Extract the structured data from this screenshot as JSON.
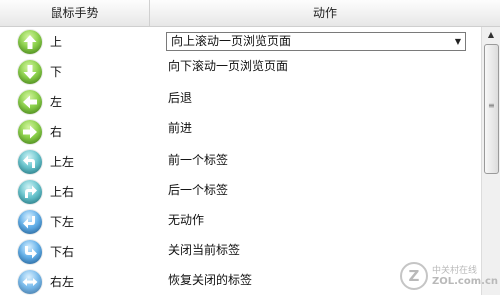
{
  "header": {
    "gesture_col": "鼠标手势",
    "action_col": "动作"
  },
  "colors": {
    "green_icon": "#7cc242",
    "blue_icon": "#4a9ee0",
    "teal_icon": "#49b3bf"
  },
  "rows": [
    {
      "gesture": "上",
      "icon": "arrow-up-icon",
      "action": "向上滚动一页浏览页面"
    },
    {
      "gesture": "下",
      "icon": "arrow-down-icon",
      "action": "向下滚动一页浏览页面"
    },
    {
      "gesture": "左",
      "icon": "arrow-left-icon",
      "action": "后退"
    },
    {
      "gesture": "右",
      "icon": "arrow-right-icon",
      "action": "前进"
    },
    {
      "gesture": "上左",
      "icon": "arrow-up-left-icon",
      "action": "前一个标签"
    },
    {
      "gesture": "上右",
      "icon": "arrow-up-right-icon",
      "action": "后一个标签"
    },
    {
      "gesture": "下左",
      "icon": "arrow-down-left-icon",
      "action": "无动作"
    },
    {
      "gesture": "下右",
      "icon": "arrow-down-right-icon",
      "action": "关闭当前标签"
    },
    {
      "gesture": "右左",
      "icon": "arrow-right-left-icon",
      "action": "恢复关闭的标签"
    }
  ],
  "scrollbar": {
    "up_arrow": "▲",
    "grip": "≡"
  },
  "dropdown_arrow": "▼",
  "watermark": {
    "logo": "Z",
    "cn": "中关村在线",
    "en": "ZOL.com.cn"
  }
}
